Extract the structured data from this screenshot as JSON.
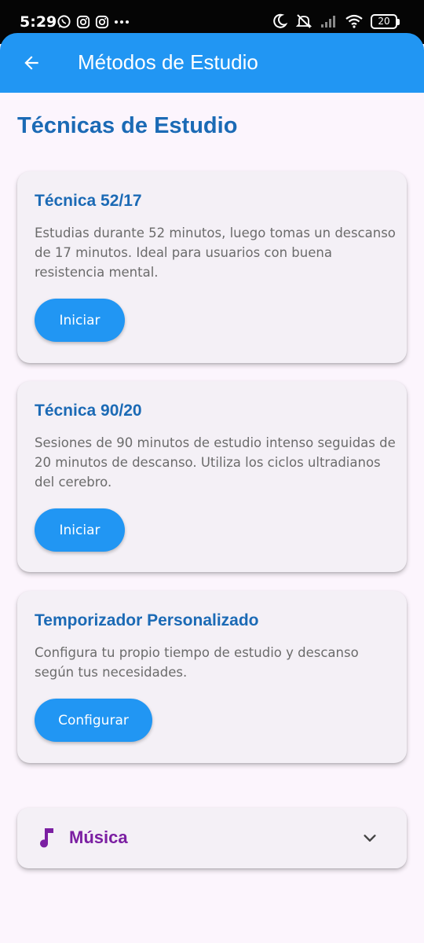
{
  "status_bar": {
    "time": "5:29",
    "battery": "20",
    "left_icons": [
      "whatsapp-icon",
      "instagram-icon",
      "instagram-icon",
      "more-dots-icon"
    ],
    "right_icons": [
      "moon-icon",
      "silent-icon",
      "signal-icon",
      "wifi-icon",
      "battery-icon"
    ]
  },
  "app_bar": {
    "title": "Métodos de Estudio",
    "back_icon": "arrow-back-icon",
    "color": "#2196F3"
  },
  "section_title": "Técnicas de Estudio",
  "cards": [
    {
      "title": "Técnica 52/17",
      "description": "Estudias durante 52 minutos, luego tomas un descanso de 17 minutos. Ideal para usuarios con buena resistencia mental.",
      "button": "Iniciar"
    },
    {
      "title": "Técnica 90/20",
      "description": "Sesiones de 90 minutos de estudio intenso seguidas de 20 minutos de descanso. Utiliza los ciclos ultradianos del cerebro.",
      "button": "Iniciar"
    },
    {
      "title": "Temporizador Personalizado",
      "description": "Configura tu propio tiempo de estudio y descanso según tus necesidades.",
      "button": "Configurar"
    }
  ],
  "music": {
    "label": "Música",
    "icon": "music-note-icon",
    "expand_icon": "chevron-down-icon",
    "color": "#7B1FA2"
  },
  "colors": {
    "primary": "#2196F3",
    "title_blue": "#1B6AB5",
    "background": "#FCF5FD",
    "card": "#F4F0F6"
  }
}
